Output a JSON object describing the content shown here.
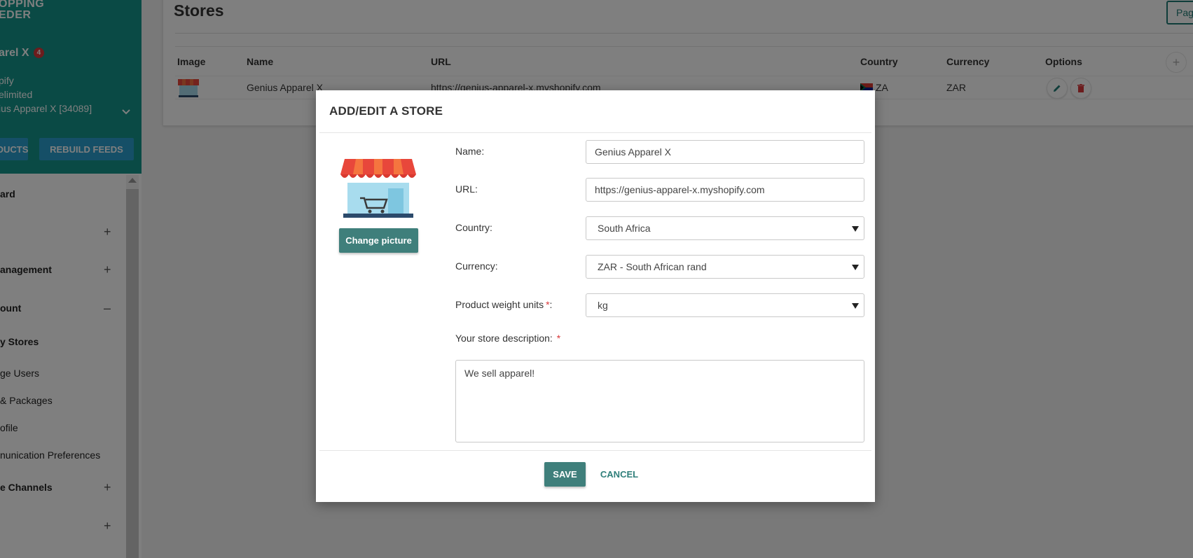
{
  "sidebar": {
    "logo_line1": "OPPING",
    "logo_line2": "EDER",
    "account_name": "arel X",
    "account_badge": "4",
    "platform": "pify",
    "plan": "elimited",
    "store_select": "ius Apparel X [34089]",
    "buttons": [
      "DUCTS",
      "REBUILD FEEDS"
    ],
    "menu": [
      {
        "label": "ard",
        "sign": ""
      },
      {
        "label": "",
        "sign": "+"
      },
      {
        "label": "anagement",
        "sign": "+"
      },
      {
        "label": "ount",
        "sign": "–"
      },
      {
        "label": "y Stores",
        "sign": ""
      },
      {
        "label": "ge Users",
        "sign": ""
      },
      {
        "label": "& Packages",
        "sign": ""
      },
      {
        "label": "ofile",
        "sign": ""
      },
      {
        "label": "nunication Preferences",
        "sign": ""
      },
      {
        "label": "e Channels",
        "sign": "+"
      },
      {
        "label": "",
        "sign": "+"
      }
    ]
  },
  "page": {
    "title": "Stores",
    "top_button": "Pag",
    "table": {
      "headers": [
        "Image",
        "Name",
        "URL",
        "Country",
        "Currency",
        "Options"
      ],
      "add_column": "+",
      "rows": [
        {
          "name": "Genius Apparel X",
          "url": "https://genius-apparel-x.myshopify.com",
          "country": "ZA",
          "currency": "ZAR"
        }
      ]
    }
  },
  "modal": {
    "title": "ADD/EDIT A STORE",
    "change_picture": "Change picture",
    "labels": {
      "name": "Name:",
      "url": "URL:",
      "country": "Country:",
      "currency": "Currency:",
      "weight": "Product weight units",
      "weight_colon": ":",
      "description": "Your store description:",
      "required": "*"
    },
    "values": {
      "name": "Genius Apparel X",
      "url": "https://genius-apparel-x.myshopify.com",
      "country": "South Africa",
      "currency": "ZAR - South African rand",
      "weight": "kg",
      "description": "We sell apparel!"
    },
    "save": "SAVE",
    "cancel": "CANCEL"
  },
  "colors": {
    "brand_teal": "#14948a",
    "button_teal": "#3f7f7b",
    "accent_blue": "#2a9fcf",
    "required_red": "#d9383a"
  }
}
